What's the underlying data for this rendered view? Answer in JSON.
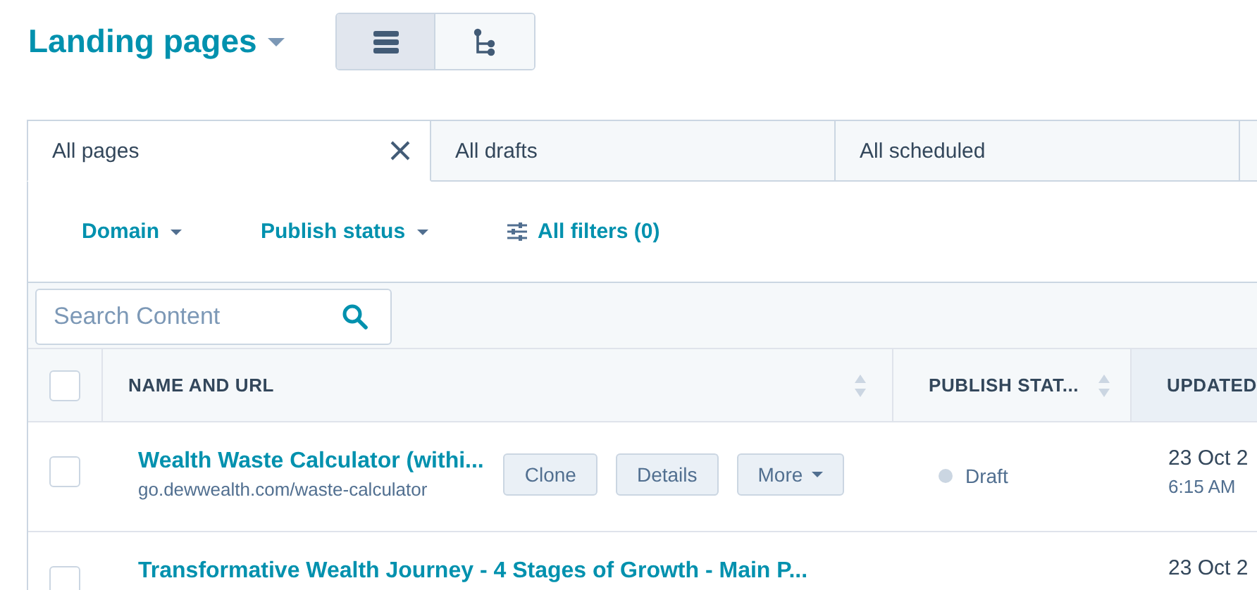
{
  "header": {
    "title": "Landing pages",
    "views": [
      {
        "kind": "list",
        "selected": true
      },
      {
        "kind": "tree",
        "selected": false
      }
    ]
  },
  "tabs": [
    {
      "label": "All pages",
      "selected": true,
      "closable": true
    },
    {
      "label": "All drafts",
      "selected": false,
      "closable": false
    },
    {
      "label": "All scheduled",
      "selected": false,
      "closable": false
    },
    {
      "selected": false
    }
  ],
  "filters": [
    {
      "kind": "dropdown",
      "label": "Domain"
    },
    {
      "kind": "dropdown",
      "label": "Publish status"
    },
    {
      "kind": "all",
      "label": "All filters (0)"
    }
  ],
  "search": {
    "placeholder": "Search Content"
  },
  "table": {
    "all_checked": false,
    "columns": [
      "NAME AND URL",
      "PUBLISH STAT...",
      "UPDATED"
    ],
    "rows": [
      {
        "name": "Wealth Waste Calculator (withi...",
        "url": "go.dewwealth.com/waste-calculator",
        "status": "Draft",
        "date": "23 Oct 2",
        "time": "6:15 AM",
        "actions": [
          "Clone",
          "Details",
          "More"
        ],
        "checked": false
      },
      {
        "name": "Transformative Wealth Journey - 4 Stages of Growth - Main P...",
        "date": "23 Oct 2",
        "actions": [],
        "checked": false
      }
    ]
  }
}
